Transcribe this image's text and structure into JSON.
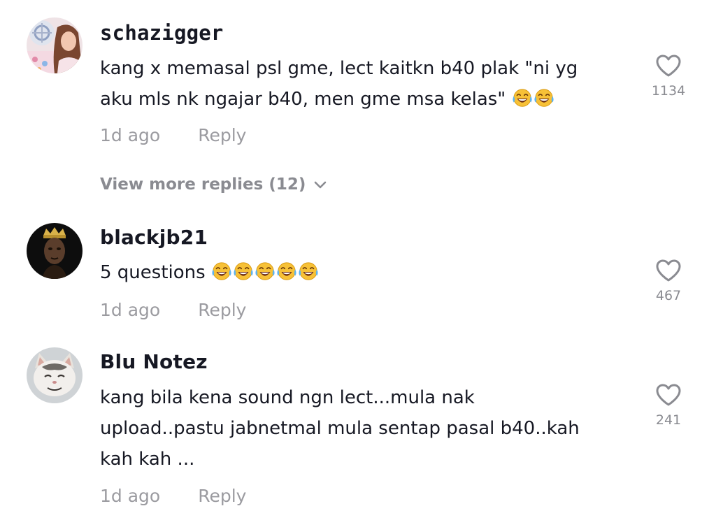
{
  "comments": [
    {
      "username": "schazigger",
      "text_lines": [
        "kang x memasal psl gme, lect kaitkn b40 plak \"ni yg",
        "aku mls nk ngajar b40, men gme msa kelas\""
      ],
      "emoji": [
        "face-with-tears-of-joy-icon",
        "face-with-tears-of-joy-icon"
      ],
      "time": "1d ago",
      "reply_label": "Reply",
      "likes": "1134"
    },
    {
      "username": "blackjb21",
      "text_lines": [
        "5 questions"
      ],
      "emoji": [
        "face-with-tears-of-joy-icon",
        "face-with-tears-of-joy-icon",
        "face-with-tears-of-joy-icon",
        "face-with-tears-of-joy-icon",
        "face-with-tears-of-joy-icon"
      ],
      "time": "1d ago",
      "reply_label": "Reply",
      "likes": "467"
    },
    {
      "username": "Blu Notez",
      "text_lines": [
        "kang bila kena sound ngn lect...mula nak",
        "upload..pastu jabnetmal mula sentap pasal b40..kah",
        "kah kah ..."
      ],
      "time": "1d ago",
      "reply_label": "Reply",
      "likes": "241"
    }
  ],
  "view_more_replies": "View more replies (12)",
  "icons": {
    "like": "heart-outline-icon",
    "expand": "chevron-down-icon"
  },
  "colors": {
    "text_primary": "#161823",
    "text_secondary": "#9b9ba0",
    "icon": "#8a8b91"
  }
}
